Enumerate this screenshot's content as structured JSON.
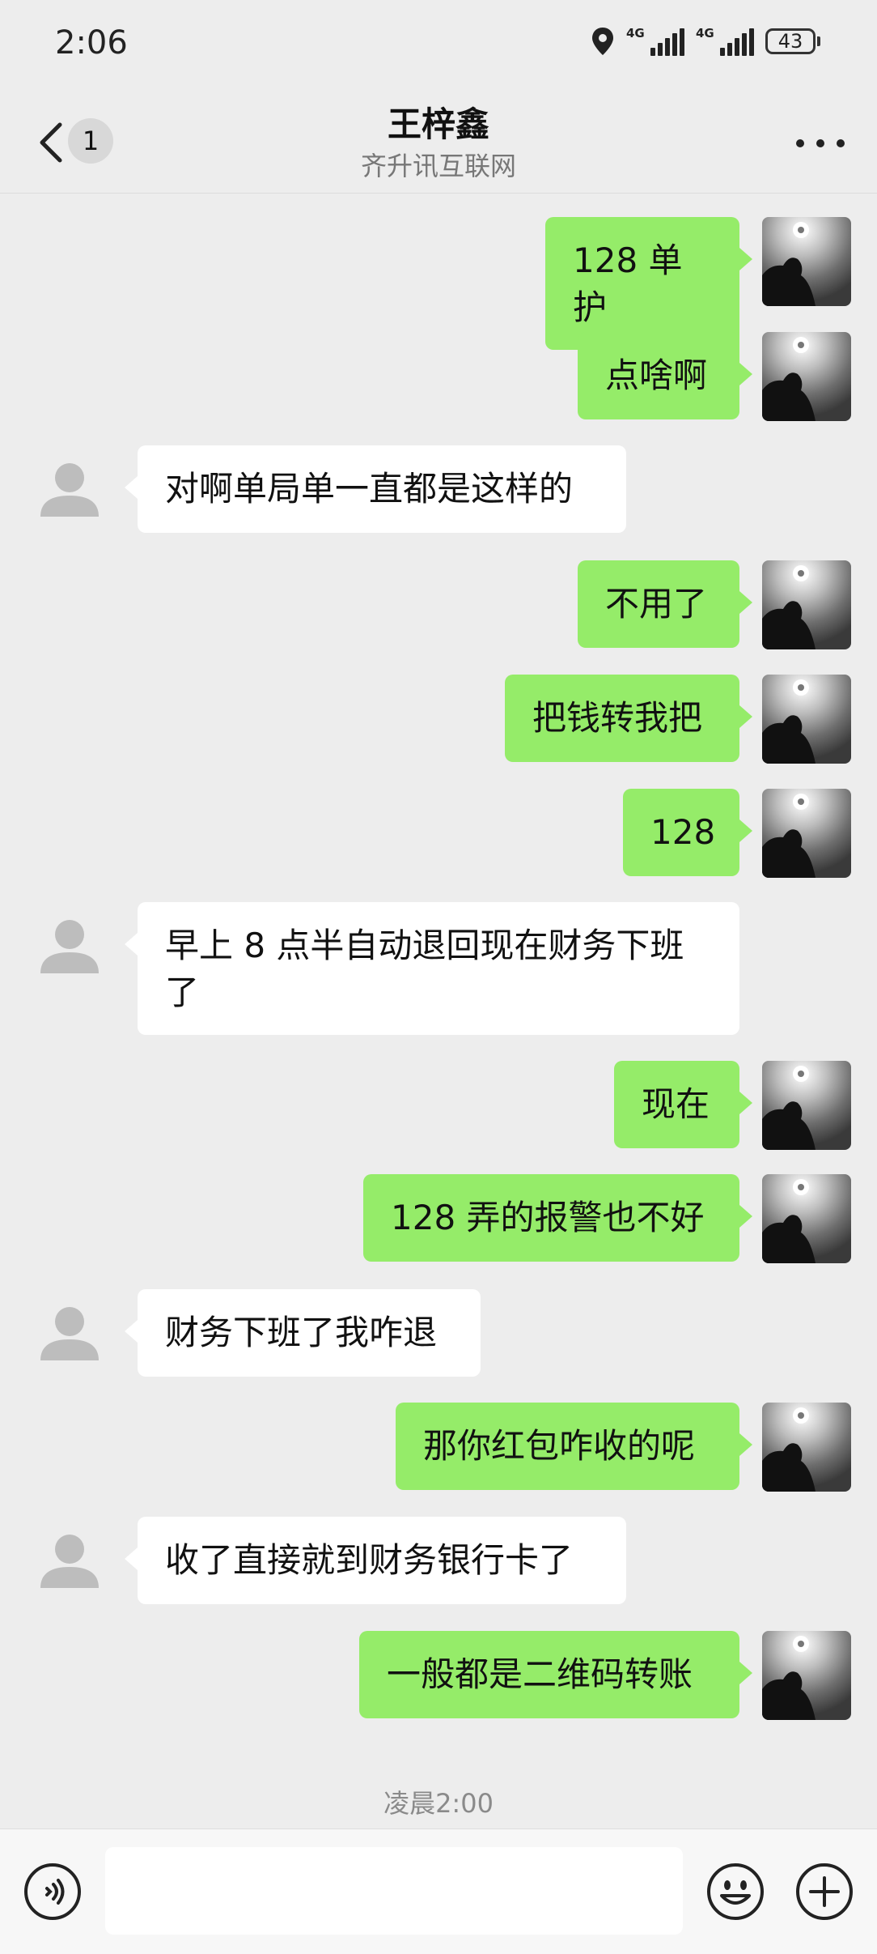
{
  "status_bar": {
    "time": "2:06",
    "signal_1_label": "4G",
    "signal_2_label": "4G",
    "battery": "43"
  },
  "header": {
    "back_badge": "1",
    "title": "王梓鑫",
    "subtitle": "齐升讯互联网"
  },
  "messages": [
    {
      "sender": "me",
      "text": "128 单护"
    },
    {
      "sender": "me",
      "text": "点啥啊"
    },
    {
      "sender": "them",
      "text": "对啊单局单一直都是这样的"
    },
    {
      "sender": "me",
      "text": "不用了"
    },
    {
      "sender": "me",
      "text": "把钱转我把"
    },
    {
      "sender": "me",
      "text": "128"
    },
    {
      "sender": "them",
      "text": "早上 8 点半自动退回现在财务下班了"
    },
    {
      "sender": "me",
      "text": "现在"
    },
    {
      "sender": "me",
      "text": "128 弄的报警也不好"
    },
    {
      "sender": "them",
      "text": "财务下班了我咋退"
    },
    {
      "sender": "me",
      "text": "那你红包咋收的呢"
    },
    {
      "sender": "them",
      "text": "收了直接就到财务银行卡了"
    },
    {
      "sender": "me",
      "text": "一般都是二维码转账"
    }
  ],
  "time_separator": "凌晨2:00",
  "input": {
    "value": ""
  },
  "icons": {
    "location": "location-icon",
    "back": "chevron-left-icon",
    "more": "more-icon",
    "voice": "voice-icon",
    "emoji": "emoji-icon",
    "plus": "plus-icon"
  },
  "colors": {
    "my_bubble": "#95ec69",
    "their_bubble": "#ffffff",
    "background": "#ededed"
  }
}
